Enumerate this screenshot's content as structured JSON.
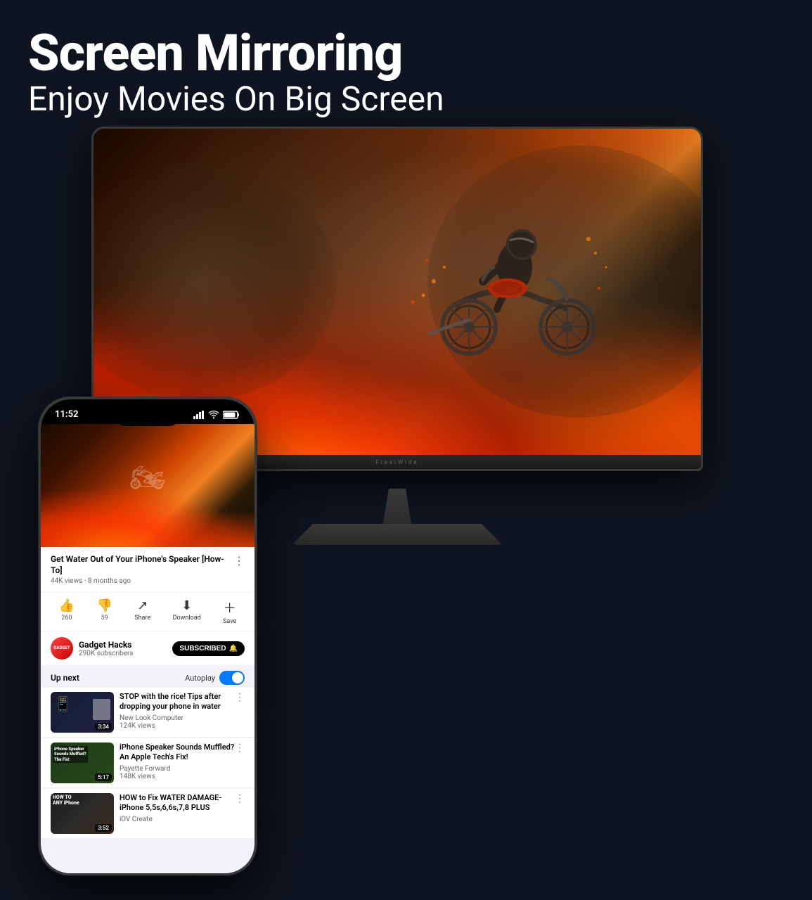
{
  "header": {
    "main_title": "Screen Mirroring",
    "sub_title": "Enjoy Movies On Big Screen"
  },
  "monitor": {
    "brand": "FlexiWide"
  },
  "phone": {
    "status_bar": {
      "time": "11:52",
      "signal": "●●●",
      "wifi": "WiFi",
      "battery": "▮▮▮"
    },
    "current_video": {
      "title": "Get Water Out of Your iPhone's Speaker [How-To]",
      "views": "44K views",
      "age": "8 months ago",
      "like_count": "260",
      "dislike_count": "59",
      "share_label": "Share",
      "download_label": "Download",
      "save_label": "Save"
    },
    "channel": {
      "name": "Gadget Hacks",
      "subscribers": "290K subscribers",
      "avatar_text": "GADGET",
      "subscribed_label": "SUBSCRIBED"
    },
    "up_next": {
      "label": "Up next",
      "autoplay_label": "Autoplay"
    },
    "recommended_videos": [
      {
        "title": "STOP with the rice! Tips after dropping your phone in water",
        "channel": "New Look Computer",
        "views": "124K views",
        "duration": "3:34"
      },
      {
        "title": "iPhone Speaker Sounds Muffled? An Apple Tech's Fix!",
        "channel": "Payette Forward",
        "views": "148K views",
        "duration": "5:17"
      },
      {
        "title": "HOW to Fix WATER DAMAGE- iPhone 5,5s,6,6s,7,8 PLUS",
        "channel": "iDV Create",
        "views": "",
        "duration": "3:52"
      }
    ]
  }
}
